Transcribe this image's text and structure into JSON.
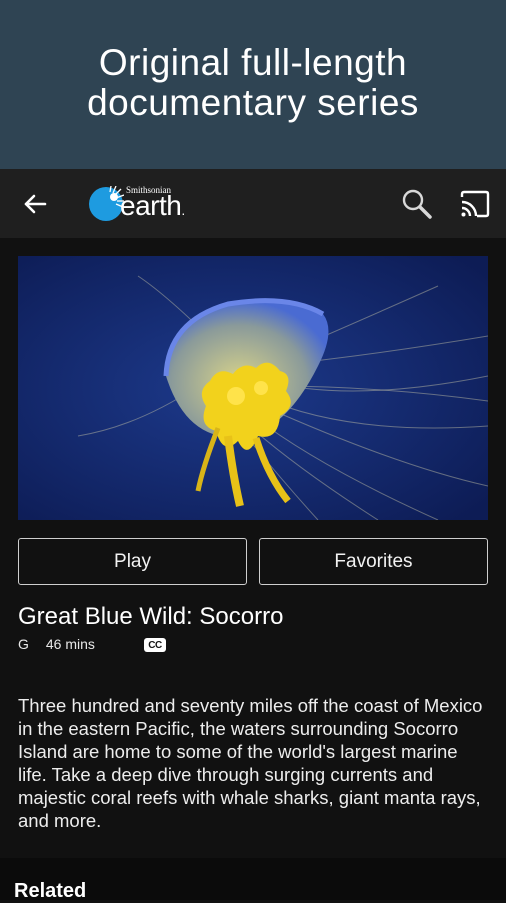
{
  "banner": {
    "title": "Original full-length\ndocumentary series"
  },
  "appbar": {
    "logo_small": "Smithsonian",
    "logo_main": "earth",
    "logo_dot": ".",
    "icons": [
      "back-arrow-icon",
      "search-icon",
      "cast-icon"
    ]
  },
  "video": {
    "title": "Great Blue Wild: Socorro",
    "rating": "G",
    "duration": "46 mins",
    "cc": "CC",
    "play_label": "Play",
    "favorites_label": "Favorites",
    "description": "Three hundred and seventy miles off the coast of Mexico in the eastern Pacific, the waters surrounding Socorro Island are home to some of the world's largest marine life. Take a deep dive through surging currents and majestic coral reefs with whale sharks, giant manta rays, and more."
  },
  "related": {
    "label": "Related"
  },
  "colors": {
    "banner_bg": "#2f4453",
    "appbar_bg": "#1f1f1f",
    "page_bg": "#111111",
    "logo_blue": "#1e9be0",
    "ocean": "#16286a",
    "jelly_yellow": "#f2d21c"
  }
}
